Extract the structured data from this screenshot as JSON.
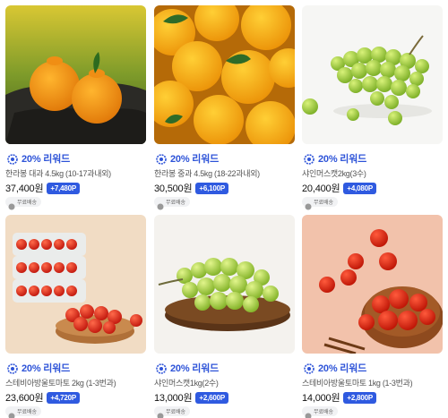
{
  "products": [
    {
      "reward": "20% 리워드",
      "name": "한라봉 대과 4.5kg (10-17과내외)",
      "price": "37,400원",
      "points": "+7,480P",
      "shipping": "무료배송",
      "image": "hallabong-large-photo"
    },
    {
      "reward": "20% 리워드",
      "name": "한라봉 중과 4.5kg (18-22과내외)",
      "price": "30,500원",
      "points": "+6,100P",
      "shipping": "무료배송",
      "image": "hallabong-medium-photo"
    },
    {
      "reward": "20% 리워드",
      "name": "샤인머스캣2kg(3수)",
      "price": "20,400원",
      "points": "+4,080P",
      "shipping": "무료배송",
      "image": "shine-muscat-photo"
    },
    {
      "reward": "20% 리워드",
      "name": "스테비아방울토마토 2kg (1-3번과)",
      "price": "23,600원",
      "points": "+4,720P",
      "shipping": "무료배송",
      "image": "tomato-box-photo"
    },
    {
      "reward": "20% 리워드",
      "name": "샤인머스캣1kg(2수)",
      "price": "13,000원",
      "points": "+2,600P",
      "shipping": "무료배송",
      "image": "shine-muscat-plate-photo"
    },
    {
      "reward": "20% 리워드",
      "name": "스테비아방울토마토 1kg (1-3번과)",
      "price": "14,000원",
      "points": "+2,800P",
      "shipping": "무료배송",
      "image": "tomato-bowl-photo"
    }
  ],
  "colors": {
    "accent": "#2d53d8",
    "badge": "#2f5ae0"
  }
}
